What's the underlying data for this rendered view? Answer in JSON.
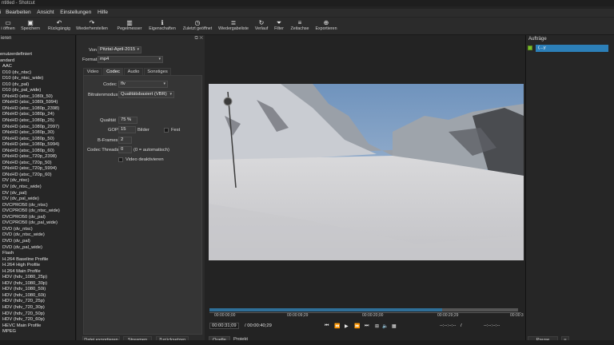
{
  "window": {
    "title": "ntitled - Shotcut"
  },
  "menu": [
    "i",
    "Bearbeiten",
    "Ansicht",
    "Einstellungen",
    "Hilfe"
  ],
  "toolbar": [
    {
      "label": "i öffnen",
      "icon": "folder-open-icon",
      "glyph": "▭"
    },
    {
      "label": "Speichern",
      "icon": "save-icon",
      "glyph": "▣"
    },
    {
      "label": "Rückgängig",
      "icon": "undo-icon",
      "glyph": "↶"
    },
    {
      "label": "Wiederherstellen",
      "icon": "redo-icon",
      "glyph": "↷"
    },
    {
      "label": "Pegelmesser",
      "icon": "level-meter-icon",
      "glyph": "▥"
    },
    {
      "label": "Eigenschaften",
      "icon": "info-icon",
      "glyph": "ℹ"
    },
    {
      "label": "Zuletzt geöffnet",
      "icon": "recent-clock-icon",
      "glyph": "◷"
    },
    {
      "label": "Wiedergabeliste",
      "icon": "playlist-icon",
      "glyph": "≣"
    },
    {
      "label": "Verlauf",
      "icon": "history-icon",
      "glyph": "↻"
    },
    {
      "label": "Filter",
      "icon": "filter-icon",
      "glyph": "⏷"
    },
    {
      "label": "Zeitachse",
      "icon": "timeline-icon",
      "glyph": "≡"
    },
    {
      "label": "Exportieren",
      "icon": "export-icon",
      "glyph": "⊕"
    }
  ],
  "presets": {
    "header": "ieren",
    "items": [
      "enutzerdefiniert",
      "andard",
      "AAC",
      "D10 (dv_ntsc)",
      "D10 (dv_ntsc_wide)",
      "D10 (dv_pal)",
      "D10 (dv_pal_wide)",
      "DNxHD (atsc_1080i_50)",
      "DNxHD (atsc_1080i_5994)",
      "DNxHD (atsc_1080p_2398)",
      "DNxHD (atsc_1080p_24)",
      "DNxHD (atsc_1080p_25)",
      "DNxHD (atsc_1080p_2997)",
      "DNxHD (atsc_1080p_30)",
      "DNxHD (atsc_1080p_50)",
      "DNxHD (atsc_1080p_5994)",
      "DNxHD (atsc_1080p_60)",
      "DNxHD (atsc_720p_2398)",
      "DNxHD (atsc_720p_50)",
      "DNxHD (atsc_720p_5994)",
      "DNxHD (atsc_720p_60)",
      "DV (dv_ntsc)",
      "DV (dv_ntsc_wide)",
      "DV (dv_pal)",
      "DV (dv_pal_wide)",
      "DVCPRO50 (dv_ntsc)",
      "DVCPRO50 (dv_ntsc_wide)",
      "DVCPRO50 (dv_pal)",
      "DVCPRO50 (dv_pal_wide)",
      "DVD (dv_ntsc)",
      "DVD (dv_ntsc_wide)",
      "DVD (dv_pal)",
      "DVD (dv_pal_wide)",
      "Flash",
      "H.264 Baseline Profile",
      "H.264 High Profile",
      "H.264 Main Profile",
      "HDV (hdv_1080_25p)",
      "HDV (hdv_1080_30p)",
      "HDV (hdv_1080_50i)",
      "HDV (hdv_1080_60i)",
      "HDV (hdv_720_25p)",
      "HDV (hdv_720_30p)",
      "HDV (hdv_720_50p)",
      "HDV (hdv_720_60p)",
      "HEVC Main Profile",
      "MPEG"
    ]
  },
  "settings": {
    "von_label": "Von",
    "von_value": "Pitztal-April-2015",
    "format_label": "Format",
    "format_value": "mp4",
    "tabs": [
      "Video",
      "Codec",
      "Audio",
      "Sonstiges"
    ],
    "codec_label": "Codec",
    "codec_value": "flv",
    "bitrate_label": "Bitratenmodus",
    "bitrate_value": "Qualitätsbasiert (VBR)",
    "quality_label": "Qualität",
    "quality_value": "75 %",
    "gop_label": "GOP",
    "gop_value": "15",
    "gop_unit": "Bilder",
    "fest_label": "Fest",
    "bframes_label": "B-Frames",
    "bframes_value": "2",
    "threads_label": "Codec Threads",
    "threads_value": "0",
    "threads_hint": "(0 = automatisch)",
    "disable_video_label": "Video deaktivieren",
    "btn_export": "Datei exportieren",
    "btn_stream": "Streamen",
    "btn_reset": "Zurücksetzen"
  },
  "player": {
    "ticks": [
      "00:00:00;00",
      "00:00:09;29",
      "00:00:20;00",
      "00:00:29;29",
      "00:00:3"
    ],
    "progress": 0.755,
    "position": "00:00:31;09",
    "duration": "/ 00:00:40;29",
    "in_point": "--:--:--:--",
    "out_separator": "/",
    "out_point": "--:--:--:--",
    "tabs": [
      "Quelle",
      "Projekt"
    ]
  },
  "jobs": {
    "header": "Aufträge",
    "job_label": "(...y",
    "pause_label": "Pause",
    "menu_glyph": "≡"
  }
}
